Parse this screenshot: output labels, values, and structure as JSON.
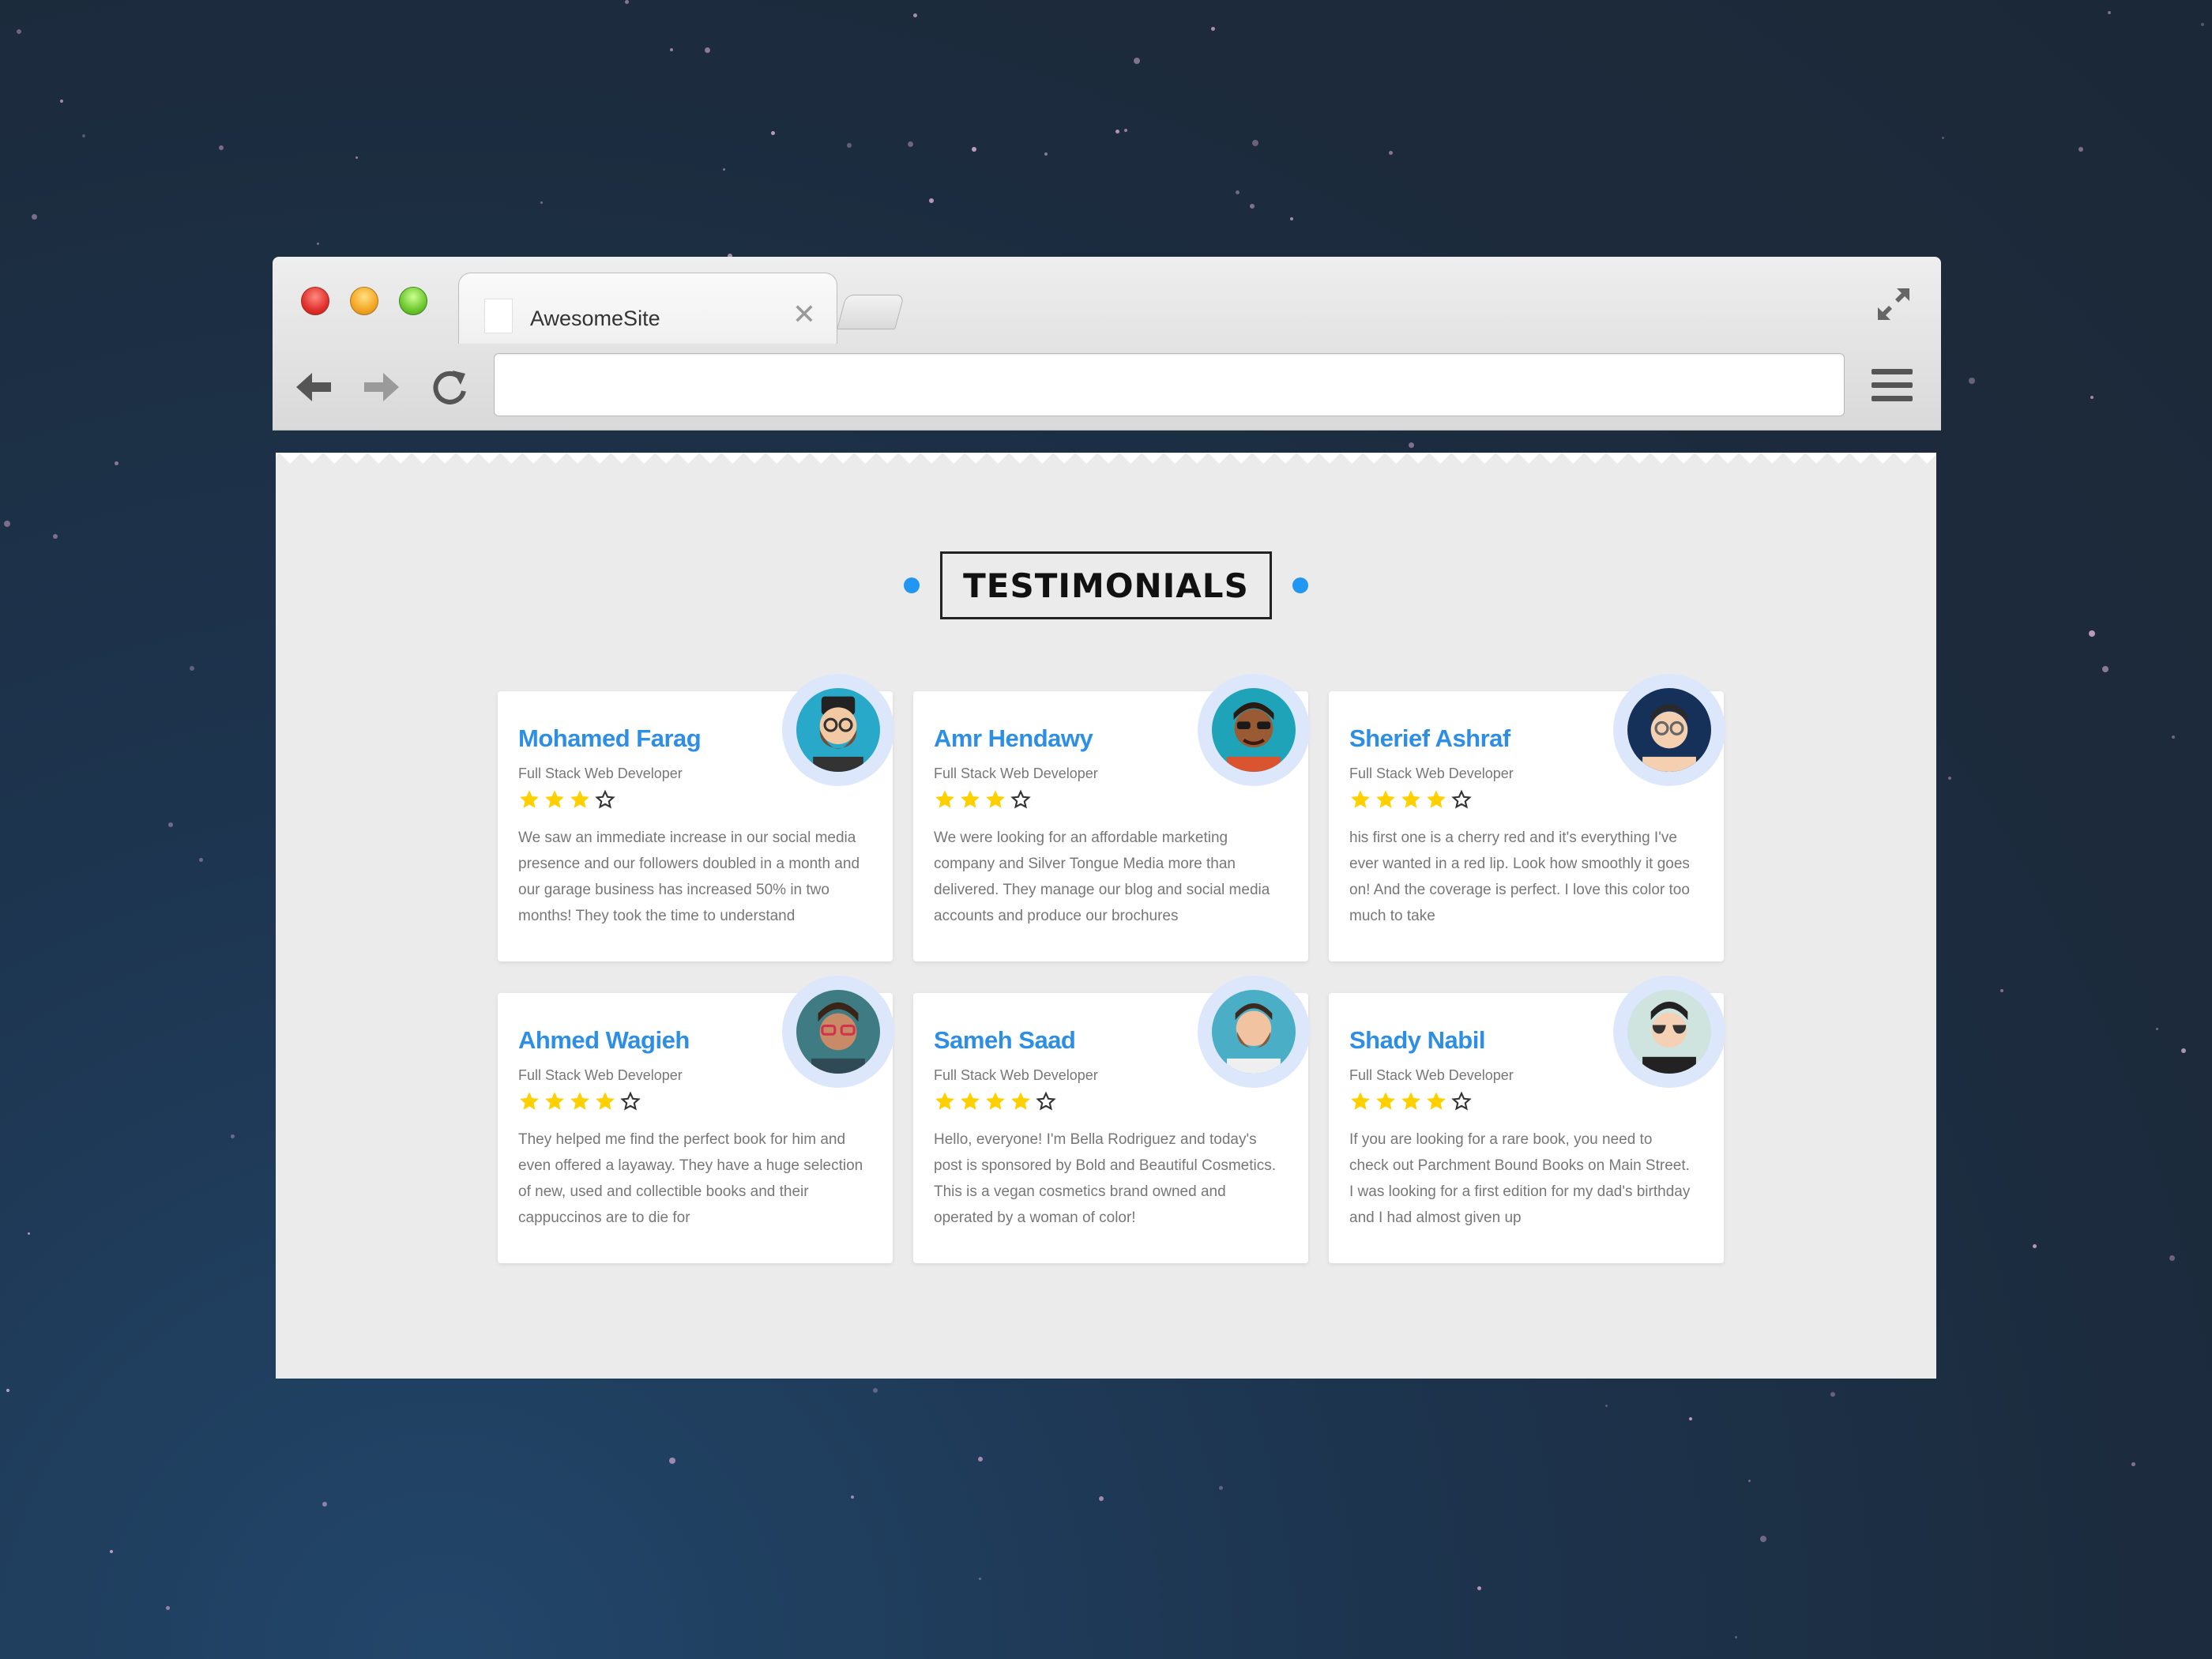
{
  "browser": {
    "tab_title": "AwesomeSite",
    "tab_close": "✕",
    "address_value": ""
  },
  "page": {
    "heading": "TESTIMONIALS",
    "accent": "#2196f3",
    "name_color": "#2d8ee6",
    "star_color": "#ffd000"
  },
  "testimonials": [
    {
      "name": "Mohamed Farag",
      "role": "Full Stack Web Developer",
      "rating": 3,
      "max_rating": 4,
      "text": "We saw an immediate increase in our social media presence and our followers doubled in a month and our garage business has increased 50% in two months! They took the time to understand",
      "avatar": "bearded-man-hat-glasses-avatar"
    },
    {
      "name": "Amr Hendawy",
      "role": "Full Stack Web Developer",
      "rating": 3,
      "max_rating": 4,
      "text": "We were looking for an affordable marketing company and Silver Tongue Media more than delivered. They manage our blog and social media accounts and produce our brochures",
      "avatar": "man-sunglasses-avatar"
    },
    {
      "name": "Sherief Ashraf",
      "role": "Full Stack Web Developer",
      "rating": 4,
      "max_rating": 5,
      "text": "his first one is a cherry red and it's everything I've ever wanted in a red lip. Look how smoothly it goes on! And the coverage is perfect. I love this color too much to take",
      "avatar": "man-glasses-avatar"
    },
    {
      "name": "Ahmed Wagieh",
      "role": "Full Stack Web Developer",
      "rating": 4,
      "max_rating": 5,
      "text": "They helped me find the perfect book for him and even offered a layaway. They have a huge selection of new, used and collectible books and their cappuccinos are to die for",
      "avatar": "man-red-glasses-avatar"
    },
    {
      "name": "Sameh Saad",
      "role": "Full Stack Web Developer",
      "rating": 4,
      "max_rating": 5,
      "text": "Hello, everyone! I'm Bella Rodriguez and today's post is sponsored by Bold and Beautiful Cosmetics. This is a vegan cosmetics brand owned and operated by a woman of color!",
      "avatar": "bearded-man-avatar"
    },
    {
      "name": "Shady Nabil",
      "role": "Full Stack Web Developer",
      "rating": 4,
      "max_rating": 5,
      "text": "If you are looking for a rare book, you need to check out Parchment Bound Books on Main Street. I was looking for a first edition for my dad's birthday and I had almost given up",
      "avatar": "man-aviator-sunglasses-avatar"
    }
  ]
}
